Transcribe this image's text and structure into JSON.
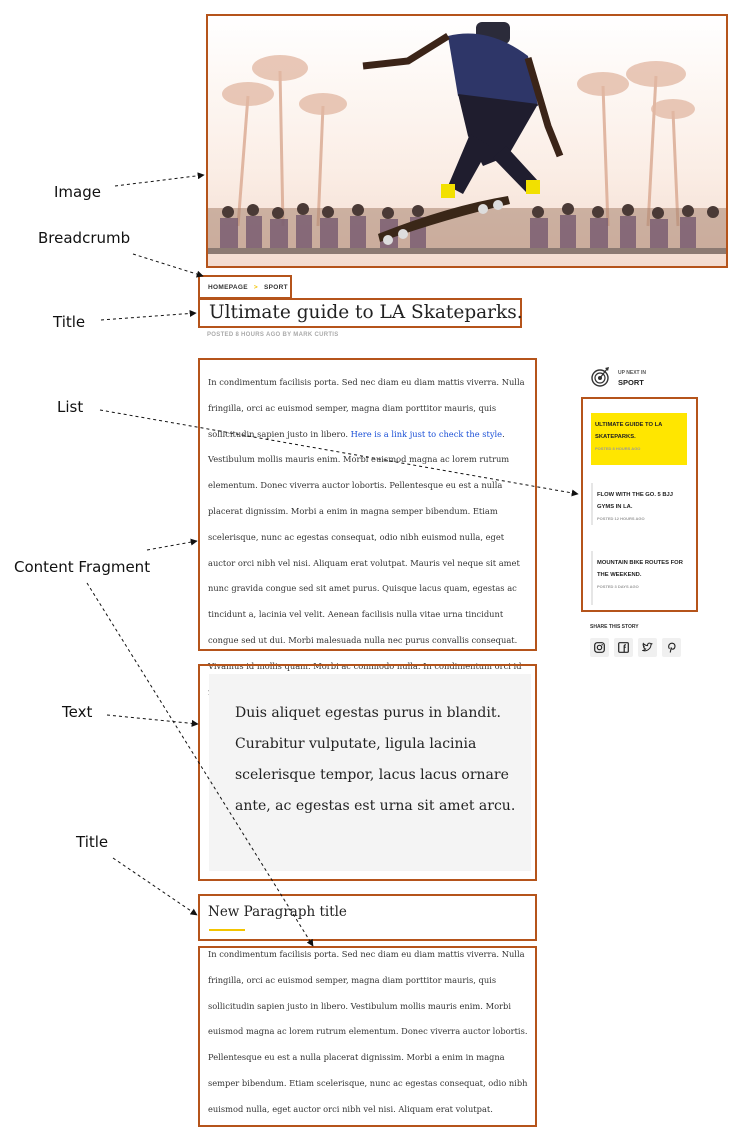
{
  "callouts": {
    "image": "Image",
    "breadcrumb": "Breadcrumb",
    "title": "Title",
    "list": "List",
    "content_fragment": "Content Fragment",
    "text": "Text",
    "title2": "Title"
  },
  "breadcrumb": {
    "home": "HOMEPAGE",
    "current": "SPORT"
  },
  "article": {
    "title": "Ultimate guide to LA Skateparks.",
    "byline": "POSTED 8 HOURS AGO BY MARK CURTIS"
  },
  "content_fragment": {
    "before_link": "In condimentum facilisis porta. Sed nec diam eu diam mattis viverra. Nulla fringilla, orci ac euismod semper, magna diam porttitor mauris, quis sollicitudin sapien justo in libero. ",
    "link": "Here is a link just to check the style",
    "after_link": ". Vestibulum mollis mauris enim. Morbi euismod magna ac lorem rutrum elementum. Donec viverra auctor lobortis. Pellentesque eu est a nulla placerat dignissim. Morbi a enim in magna semper bibendum. Etiam scelerisque, nunc ac egestas consequat, odio nibh euismod nulla, eget auctor orci nibh vel nisi. Aliquam erat volutpat. Mauris vel neque sit amet nunc gravida congue sed sit amet purus. Quisque lacus quam, egestas ac tincidunt a, lacinia vel velit. Aenean facilisis nulla vitae urna tincidunt congue sed ut dui. Morbi malesuada nulla nec purus convallis consequat. Vivamus id mollis quam. Morbi ac commodo nulla. In condimentum orci id nisl volutpat"
  },
  "quote": "Duis aliquet egestas purus in blandit. Curabitur vulputate, ligula lacinia scelerisque tempor, lacus lacus ornare ante, ac egestas est urna sit amet arcu.",
  "paragraph": {
    "title": "New Paragraph title",
    "text": "In condimentum facilisis porta. Sed nec diam eu diam mattis viverra. Nulla fringilla, orci ac euismod semper, magna diam porttitor mauris, quis sollicitudin sapien justo in libero. Vestibulum mollis mauris enim. Morbi euismod magna ac lorem rutrum elementum. Donec viverra auctor lobortis. Pellentesque eu est a nulla placerat dignissim. Morbi a enim in magna semper bibendum. Etiam scelerisque, nunc ac egestas consequat, odio nibh euismod nulla, eget auctor orci nibh vel nisi. Aliquam erat volutpat."
  },
  "sidebar": {
    "upnext_small": "UP NEXT IN",
    "upnext_category": "SPORT",
    "items": [
      {
        "title": "ULTIMATE GUIDE TO LA SKATEPARKS.",
        "meta": "POSTED 8 HOURS AGO"
      },
      {
        "title": "FLOW WITH THE GO. 5 BJJ GYMS IN LA.",
        "meta": "POSTED 12 HOURS AGO"
      },
      {
        "title": "MOUNTAIN BIKE ROUTES FOR THE WEEKEND.",
        "meta": "POSTED 3 DAYS AGO"
      }
    ],
    "share_label": "SHARE THIS STORY",
    "share_icons": [
      "instagram-icon",
      "facebook-icon",
      "twitter-icon",
      "pinterest-icon"
    ]
  },
  "colors": {
    "annotation_border": "#b5541b",
    "accent_yellow": "#ffe600",
    "link_blue": "#1a4fd6"
  }
}
